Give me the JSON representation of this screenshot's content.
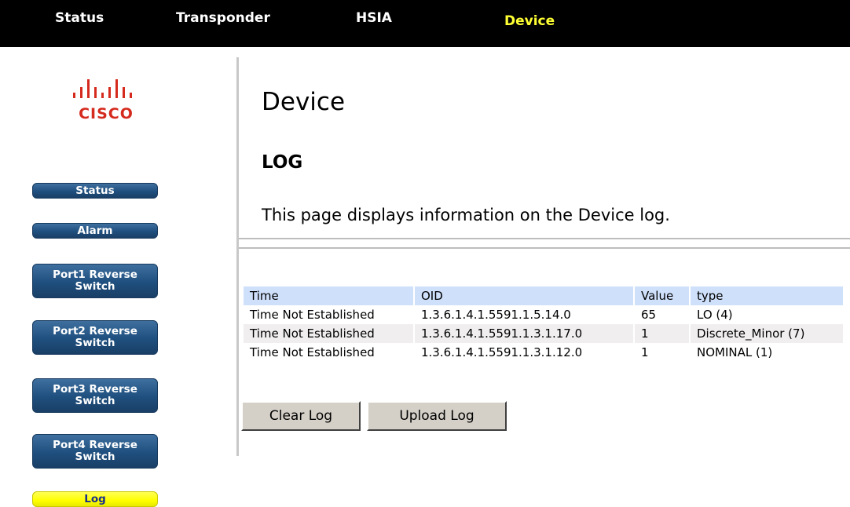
{
  "topnav": {
    "tabs": [
      {
        "label": "Status"
      },
      {
        "label": "Transponder"
      },
      {
        "label": "HSIA"
      },
      {
        "label": "Device",
        "active": true
      }
    ]
  },
  "logo": {
    "text": "CISCO"
  },
  "sidebar": {
    "items": [
      {
        "label": "Status"
      },
      {
        "label": "Alarm"
      },
      {
        "label_line1": "Port1 Reverse",
        "label_line2": "Switch"
      },
      {
        "label_line1": "Port2 Reverse",
        "label_line2": "Switch"
      },
      {
        "label_line1": "Port3 Reverse",
        "label_line2": "Switch"
      },
      {
        "label_line1": "Port4 Reverse",
        "label_line2": "Switch"
      },
      {
        "label": "Log",
        "active": true
      }
    ]
  },
  "main": {
    "page_title": "Device",
    "section_title": "LOG",
    "description": "This page displays information on the Device log.",
    "table": {
      "headers": [
        "Time",
        "OID",
        "Value",
        "type"
      ],
      "rows": [
        [
          "Time Not Established",
          "1.3.6.1.4.1.5591.1.5.14.0",
          "65",
          "LO (4)"
        ],
        [
          "Time Not Established",
          "1.3.6.1.4.1.5591.1.3.1.17.0",
          "1",
          "Discrete_Minor (7)"
        ],
        [
          "Time Not Established",
          "1.3.6.1.4.1.5591.1.3.1.12.0",
          "1",
          "NOMINAL (1)"
        ]
      ]
    },
    "buttons": {
      "clear_log": "Clear Log",
      "upload_log": "Upload Log"
    }
  },
  "colors": {
    "topbar_bg": "#000000",
    "active_tab": "#ffff33",
    "nav_button": "#1f4f7e",
    "active_nav_button": "#ffff00",
    "table_header_bg": "#cfe0fb",
    "brand_red": "#d52b1e"
  }
}
